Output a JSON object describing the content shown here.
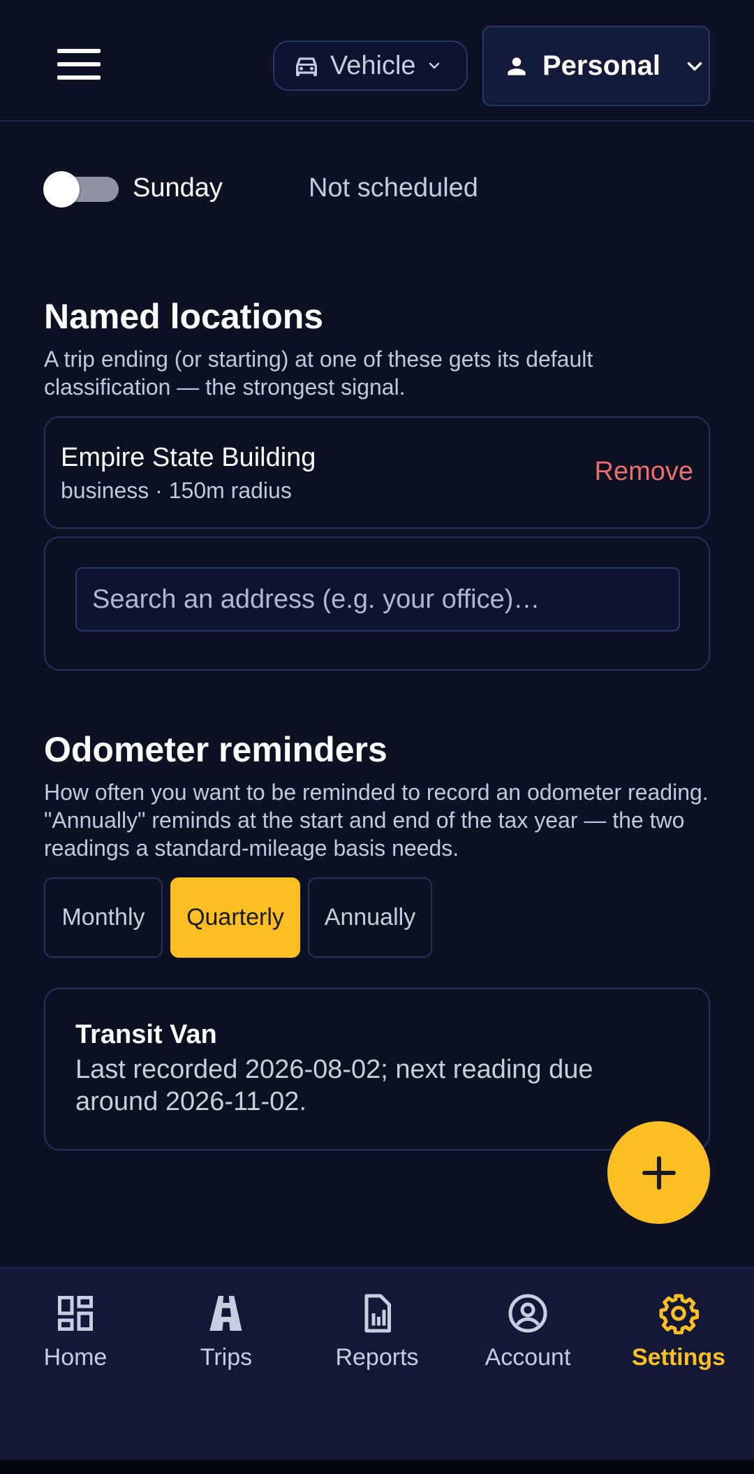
{
  "header": {
    "vehicle_selector": {
      "label": "Vehicle",
      "icon": "car-icon"
    },
    "profile_selector": {
      "label": "Personal",
      "icon": "person-icon"
    }
  },
  "schedule_row": {
    "day": "Sunday",
    "enabled": false,
    "status": "Not scheduled"
  },
  "named_locations": {
    "title": "Named locations",
    "description": "A trip ending (or starting) at one of these gets its default classification — the strongest signal.",
    "items": [
      {
        "name": "Empire State Building",
        "meta": "business · 150m radius",
        "remove_label": "Remove"
      }
    ],
    "search_placeholder": "Search an address (e.g. your office)…"
  },
  "odometer": {
    "title": "Odometer reminders",
    "description": "How often you want to be reminded to record an odometer reading. \"Annually\" reminds at the start and end of the tax year — the two readings a standard-mileage basis needs.",
    "options": [
      "Monthly",
      "Quarterly",
      "Annually"
    ],
    "selected": "Quarterly",
    "vehicle": {
      "name": "Transit Van",
      "note": "Last recorded 2026-08-02; next reading due around 2026-11-02."
    }
  },
  "fab": {
    "icon": "plus-icon"
  },
  "bottom_nav": {
    "items": [
      {
        "label": "Home",
        "icon": "dashboard-icon"
      },
      {
        "label": "Trips",
        "icon": "road-icon"
      },
      {
        "label": "Reports",
        "icon": "report-icon"
      },
      {
        "label": "Account",
        "icon": "account-circle-icon"
      },
      {
        "label": "Settings",
        "icon": "gear-icon",
        "active": true
      }
    ]
  },
  "colors": {
    "background": "#0c1124",
    "accent": "#fbbf24",
    "danger": "#ef6d6d"
  }
}
